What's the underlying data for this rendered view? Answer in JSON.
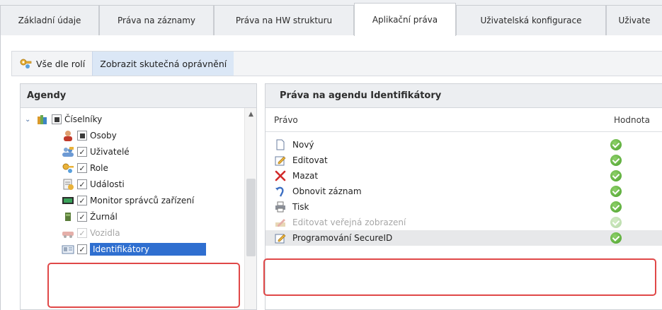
{
  "tabs": [
    {
      "label": "Základní údaje",
      "active": false
    },
    {
      "label": "Práva na záznamy",
      "active": false
    },
    {
      "label": "Práva na HW strukturu",
      "active": false
    },
    {
      "label": "Aplikační práva",
      "active": true
    },
    {
      "label": "Uživatelská konfigurace",
      "active": false
    },
    {
      "label": "Uživate",
      "active": false
    }
  ],
  "toolbar": {
    "all_by_roles": "Vše dle rolí",
    "show_actual": "Zobrazit skutečná oprávnění"
  },
  "agendy": {
    "header": "Agendy",
    "items": [
      {
        "label": "Číselníky",
        "icon": "books-icon",
        "checkbox": "partial",
        "expander": "⌄"
      },
      {
        "label": "Osoby",
        "icon": "person-icon",
        "checkbox": "partial"
      },
      {
        "label": "Uživatelé",
        "icon": "users-icon",
        "checkbox": "checked"
      },
      {
        "label": "Role",
        "icon": "role-key-icon",
        "checkbox": "checked"
      },
      {
        "label": "Události",
        "icon": "events-icon",
        "checkbox": "checked"
      },
      {
        "label": "Monitor správců zařízení",
        "icon": "monitor-icon",
        "checkbox": "checked"
      },
      {
        "label": "Žurnál",
        "icon": "journal-icon",
        "checkbox": "checked"
      },
      {
        "label": "Vozidla",
        "icon": "vehicle-icon",
        "checkbox": "checked"
      },
      {
        "label": "Identifikátory",
        "icon": "id-card-icon",
        "checkbox": "checked",
        "selected": true
      }
    ]
  },
  "prava": {
    "header": "Práva na agendu Identifikátory",
    "col_pravo": "Právo",
    "col_hodnota": "Hodnota",
    "rows": [
      {
        "label": "Nový",
        "icon": "new-doc-icon",
        "value": "ok"
      },
      {
        "label": "Editovat",
        "icon": "edit-icon",
        "value": "ok"
      },
      {
        "label": "Mazat",
        "icon": "delete-x-icon",
        "value": "ok"
      },
      {
        "label": "Obnovit záznam",
        "icon": "restore-icon",
        "value": "ok"
      },
      {
        "label": "Tisk",
        "icon": "printer-icon",
        "value": "ok"
      },
      {
        "label": "Editovat veřejná zobrazení",
        "icon": "edit-public-view-icon",
        "value": "ok"
      },
      {
        "label": "Programování SecureID",
        "icon": "edit-icon",
        "value": "ok"
      }
    ]
  },
  "colors": {
    "selection": "#2f6fd0",
    "pressed_button": "#dbe7f6",
    "annotation": "#e04848",
    "ok_green": "#4aa02b"
  }
}
